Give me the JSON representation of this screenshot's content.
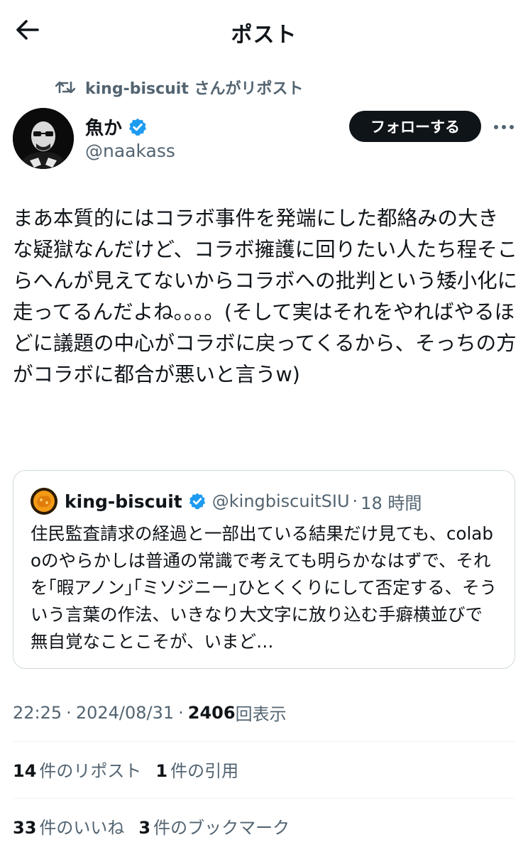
{
  "header": {
    "title": "ポスト"
  },
  "repost_context": {
    "text": "king-biscuit さんがリポスト"
  },
  "author": {
    "name": "魚か",
    "handle": "@naakass"
  },
  "follow_button": {
    "label": "フォローする"
  },
  "post": {
    "text": "まあ本質的にはコラボ事件を発端にした都絡みの大きな疑獄なんだけど、コラボ擁護に回りたい人たち程そこらへんが見えてないからコラボへの批判という矮小化に走ってるんだよね。。。。(そして実はそれをやればやるほどに議題の中心がコラボに戻ってくるから、そっちの方がコラボに都合が悪いと言うw)"
  },
  "quote": {
    "name": "king-biscuit",
    "handle": "@kingbiscuitSIU",
    "dot": "·",
    "time": "18 時間",
    "text": "住民監査請求の経過と一部出ている結果だけ見ても、colaboのやらかしは普通の常識で考えても明らかなはずで、それを｢暇アノン｣｢ミソジニー｣ひとくくりにして否定する、そういう言葉の作法、いきなり大文字に放り込む手癖横並びで無自覚なことこそが、いまど…"
  },
  "meta": {
    "time": "22:25",
    "dot1": "·",
    "date": "2024/08/31",
    "dot2": "·",
    "views": "2406",
    "views_label": "回表示"
  },
  "stats": {
    "reposts": "14",
    "reposts_label": "件のリポスト",
    "quotes": "1",
    "quotes_label": "件の引用",
    "likes": "33",
    "likes_label": "件のいいね",
    "bookmarks": "3",
    "bookmarks_label": "件のブックマーク"
  },
  "colors": {
    "text": "#0f1419",
    "secondary": "#536471",
    "verified": "#1d9bf0",
    "border": "#cfd9de"
  },
  "icons": {
    "back": "back-arrow-icon",
    "repost": "repost-icon",
    "verified": "verified-badge-icon",
    "more": "more-icon"
  }
}
